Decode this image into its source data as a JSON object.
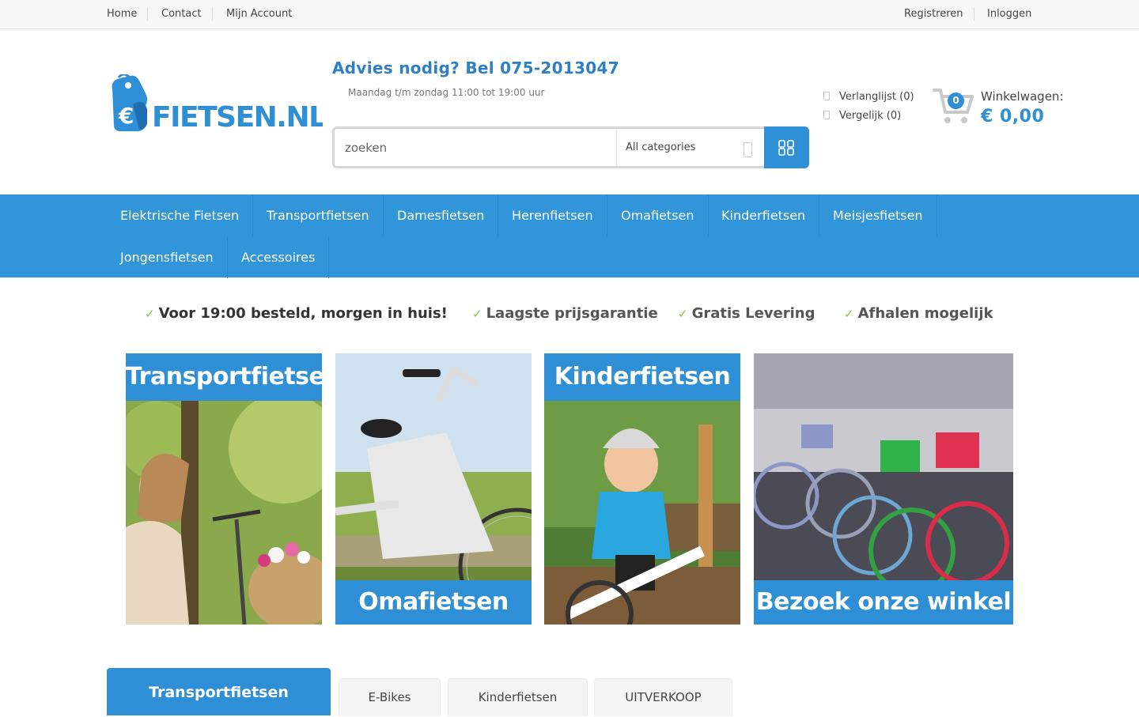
{
  "topbar": {
    "left_links": [
      "Home",
      "Contact",
      "Mijn Account"
    ],
    "right_links": [
      "Registreren",
      "Inloggen"
    ]
  },
  "header": {
    "logo_text": "FIETSEN.NL",
    "advice": "Advies nodig? Bel 075-2013047",
    "hours": "Maandag t/m zondag 11:00 tot 19:00 uur",
    "search_placeholder": "zoeken",
    "category_selected": "All categories",
    "wishlist": "Verlanglijst (0)",
    "compare": "Vergelijk (0)",
    "cart_count": "0",
    "cart_label": "Winkelwagen:",
    "cart_total": "€ 0,00"
  },
  "nav": {
    "items": [
      "Elektrische Fietsen",
      "Transportfietsen",
      "Damesfietsen",
      "Herenfietsen",
      "Omafietsen",
      "Kinderfietsen",
      "Meisjesfietsen",
      "Jongensfietsen",
      "Accessoires"
    ]
  },
  "usps": [
    "Voor 19:00 besteld, morgen in huis!",
    "Laagste prijsgarantie",
    "Gratis Levering",
    "Afhalen mogelijk"
  ],
  "banners": [
    "Transportfietsen",
    "Omafietsen",
    "Kinderfietsen",
    "Bezoek onze winkel"
  ],
  "tabs": {
    "active": "Transportfietsen",
    "others": [
      "E-Bikes",
      "Kinderfietsen",
      "UITVERKOOP"
    ]
  },
  "colors": {
    "brand_blue": "#2f8fd6",
    "nav_blue": "#3195d9",
    "tick_green": "#8cc63f"
  }
}
